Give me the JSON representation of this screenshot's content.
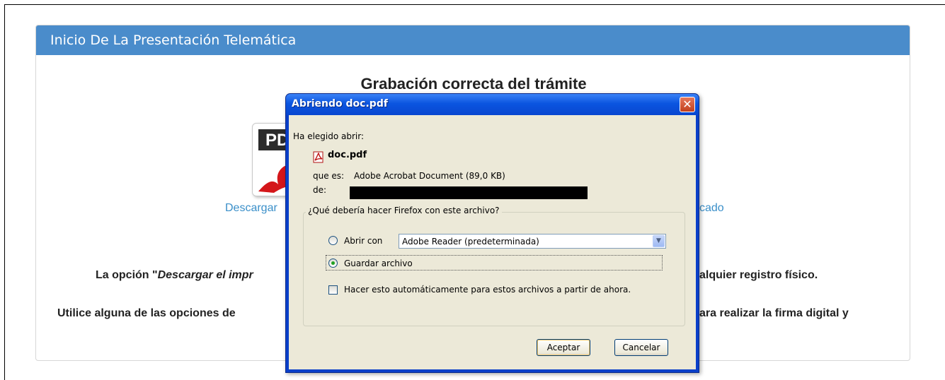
{
  "page": {
    "panel_title": "Inicio De La Presentación Telemática",
    "heading": "Grabación correcta del trámite",
    "pdf_icon_text": "PD",
    "link_left": "Descargar",
    "link_right": "cado",
    "para1_left_prefix": "La opción \"",
    "para1_left_italic": "Descargar el impr",
    "para1_right": "alquier registro físico.",
    "para2_left": "Utilice alguna de las opciones de",
    "para2_right": "ara realizar la firma digital y"
  },
  "dialog": {
    "title": "Abriendo doc.pdf",
    "close_glyph": "✕",
    "chosen_label": "Ha elegido abrir:",
    "file_name": "doc.pdf",
    "type_label": "que es:",
    "type_value": "Adobe Acrobat Document (89,0 KB)",
    "from_label": "de:",
    "question": "¿Qué debería hacer Firefox con este archivo?",
    "open_with_label": "Abrir con",
    "open_with_value": "Adobe Reader  (predeterminada)",
    "save_label": "Guardar archivo",
    "save_selected": true,
    "auto_label": "Hacer esto automáticamente para estos archivos a partir de ahora.",
    "auto_checked": false,
    "ok_label": "Aceptar",
    "cancel_label": "Cancelar"
  },
  "colors": {
    "header_blue": "#4a8ccb",
    "link_blue": "#3a8fc9",
    "dialog_title_blue": "#0b55e0",
    "dialog_bg": "#ece9d8"
  },
  "icons": [
    "pdf-file-icon",
    "close-icon",
    "radio-icon",
    "checkbox-icon",
    "dropdown-arrow-icon"
  ]
}
